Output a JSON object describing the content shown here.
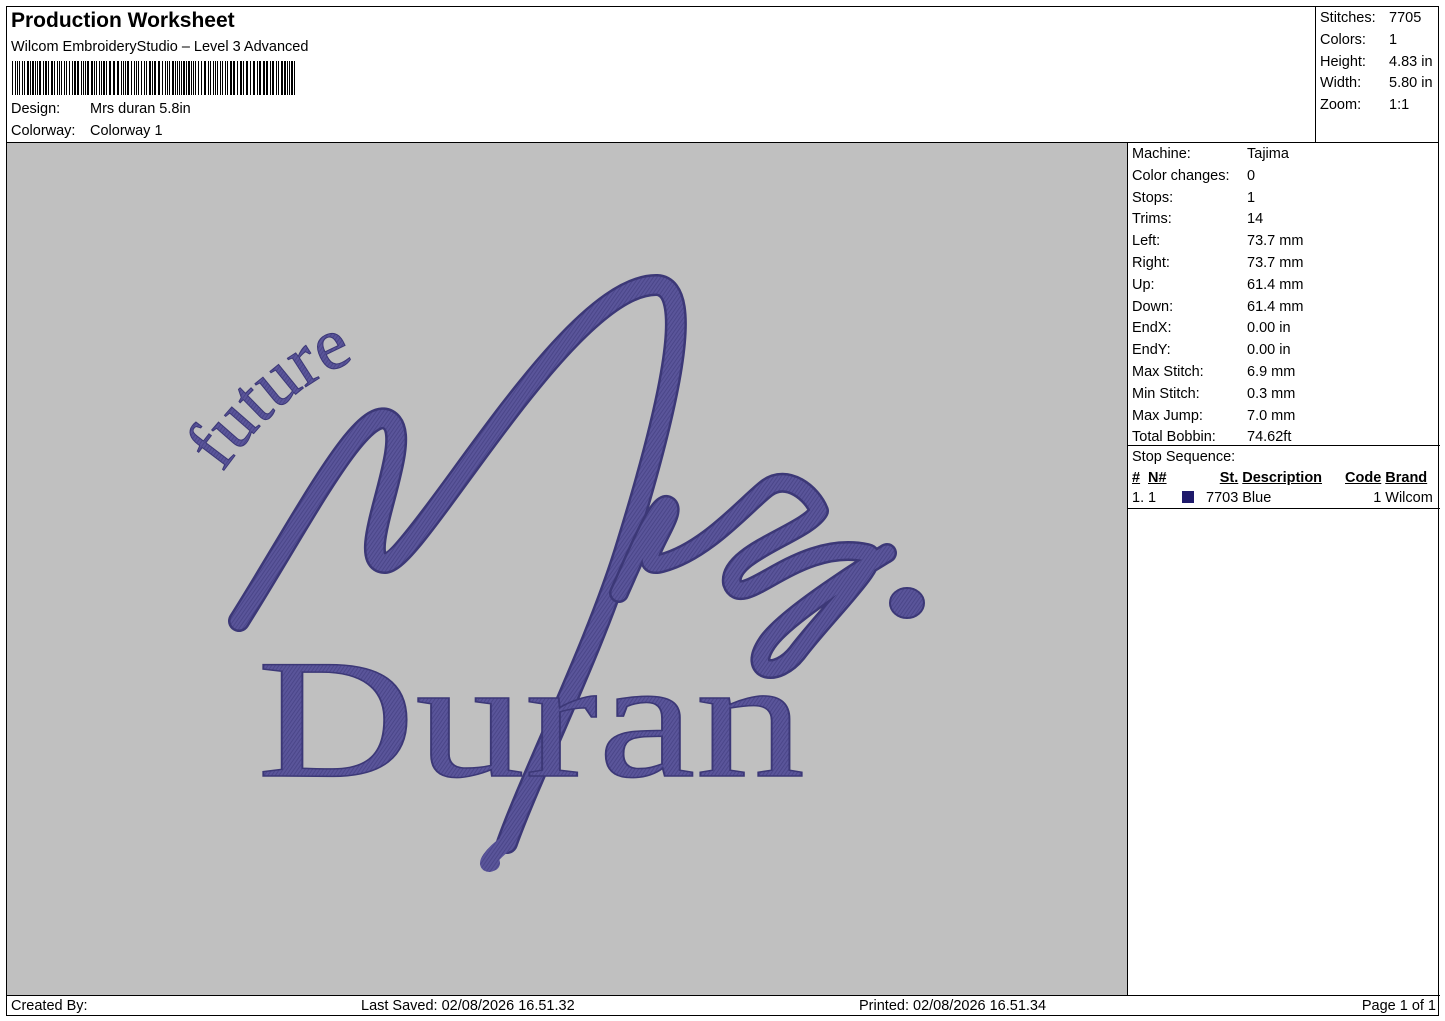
{
  "header": {
    "title": "Production Worksheet",
    "subtitle": "Wilcom EmbroideryStudio – Level 3 Advanced",
    "design_label": "Design:",
    "design_value": "Mrs duran 5.8in",
    "colorway_label": "Colorway:",
    "colorway_value": "Colorway 1"
  },
  "stats": [
    {
      "label": "Stitches:",
      "value": "7705"
    },
    {
      "label": "Colors:",
      "value": "1"
    },
    {
      "label": "Height:",
      "value": "4.83 in"
    },
    {
      "label": "Width:",
      "value": "5.80 in"
    },
    {
      "label": "Zoom:",
      "value": "1:1"
    }
  ],
  "machine": [
    {
      "label": "Machine:",
      "value": "Tajima"
    },
    {
      "label": "Color changes:",
      "value": "0"
    },
    {
      "label": "Stops:",
      "value": "1"
    },
    {
      "label": "Trims:",
      "value": "14"
    },
    {
      "label": "Left:",
      "value": "73.7 mm"
    },
    {
      "label": "Right:",
      "value": "73.7 mm"
    },
    {
      "label": "Up:",
      "value": "61.4 mm"
    },
    {
      "label": "Down:",
      "value": "61.4 mm"
    },
    {
      "label": "EndX:",
      "value": "0.00 in"
    },
    {
      "label": "EndY:",
      "value": "0.00 in"
    },
    {
      "label": "Max Stitch:",
      "value": "6.9 mm"
    },
    {
      "label": "Min Stitch:",
      "value": "0.3 mm"
    },
    {
      "label": "Max Jump:",
      "value": "7.0 mm"
    },
    {
      "label": "Total Bobbin:",
      "value": "74.62ft"
    }
  ],
  "stop_sequence": {
    "label": "Stop Sequence:",
    "headers": {
      "num": "#",
      "n": "N#",
      "st": "St.",
      "description": "Description",
      "code": "Code",
      "brand": "Brand"
    },
    "rows": [
      {
        "num": "1.",
        "n": "1",
        "st": "7703",
        "description": "Blue",
        "code": "1",
        "brand": "Wilcom",
        "color": "#1f1a6b"
      }
    ]
  },
  "design_artwork": {
    "line_future": "future",
    "line_surname": "Duran",
    "thread_color": "#5a559a",
    "thread_shadow": "#3c3877",
    "background_color": "#c0c0c0"
  },
  "footer": {
    "created_by": "Created By:",
    "last_saved": "Last Saved: 02/08/2026 16.51.32",
    "printed": "Printed: 02/08/2026 16.51.34",
    "page": "Page 1 of 1"
  }
}
